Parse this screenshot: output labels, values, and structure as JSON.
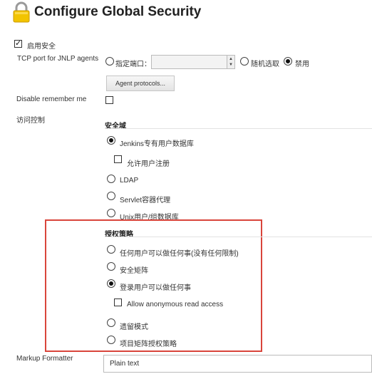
{
  "header": {
    "title": "Configure Global Security",
    "icon": "lock-icon"
  },
  "enable_security": {
    "label": "启用安全",
    "checked": true
  },
  "jnlp": {
    "label": "TCP port for JNLP agents",
    "fixed_label": "指定端口：",
    "port_value": "",
    "random_label": "随机选取",
    "disable_label": "禁用",
    "selected": "disable",
    "agent_protocols_button": "Agent protocols..."
  },
  "remember_me": {
    "label": "Disable remember me",
    "checked": false
  },
  "access_control": {
    "label": "访问控制",
    "security_realm": {
      "header": "安全域",
      "options": [
        "Jenkins专有用户数据库",
        "LDAP",
        "Servlet容器代理",
        "Unix用户/组数据库"
      ],
      "selected_index": 0,
      "allow_signup_label": "允许用户注册",
      "allow_signup_checked": false
    },
    "authorization": {
      "header": "授权策略",
      "options": [
        "任何用户可以做任何事(没有任何限制)",
        "安全矩阵",
        "登录用户可以做任何事",
        "遗留模式",
        "项目矩阵授权策略"
      ],
      "selected_index": 2,
      "anon_read_label": "Allow anonymous read access",
      "anon_read_checked": false
    }
  },
  "markup_formatter": {
    "label": "Markup Formatter",
    "value": "Plain text"
  },
  "colors": {
    "highlight_border": "#d9453b",
    "lock_gold": "#f2c400"
  }
}
